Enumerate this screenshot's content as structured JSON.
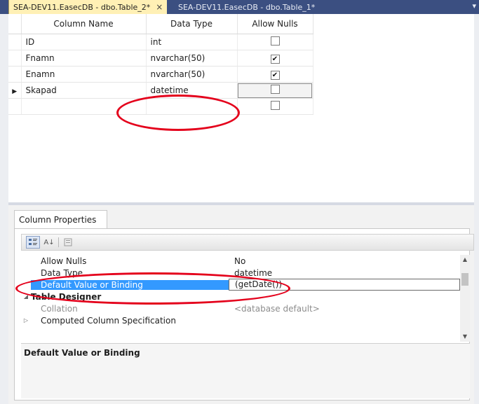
{
  "tabs": {
    "active": "SEA-DEV11.EasecDB - dbo.Table_2*",
    "close_glyph": "×",
    "inactive": "SEA-DEV11.EasecDB - dbo.Table_1*",
    "menu_glyph": "▾"
  },
  "grid": {
    "headers": [
      "Column Name",
      "Data Type",
      "Allow Nulls"
    ],
    "rows": [
      {
        "name": "ID",
        "type": "int",
        "allow_nulls": false
      },
      {
        "name": "Fnamn",
        "type": "nvarchar(50)",
        "allow_nulls": true
      },
      {
        "name": "Enamn",
        "type": "nvarchar(50)",
        "allow_nulls": true
      },
      {
        "name": "Skapad",
        "type": "datetime",
        "allow_nulls": false,
        "current": true
      },
      {
        "name": "",
        "type": "",
        "allow_nulls": false
      }
    ],
    "row_marker": "▶",
    "check_glyph": "✔"
  },
  "properties": {
    "tab_label": "Column Properties",
    "toolbar": {
      "categorized_icon": "categorized-icon",
      "alpha_label": "A↓",
      "property_pages_icon": "property-pages-icon"
    },
    "rows": [
      {
        "name": "Allow Nulls",
        "value": "No"
      },
      {
        "name": "Data Type",
        "value": "datetime"
      },
      {
        "name": "Default Value or Binding",
        "value": "(getDate())"
      },
      {
        "name": "Table Designer",
        "value": ""
      },
      {
        "name": "Collation",
        "value": "<database default>"
      },
      {
        "name": "Computed Column Specification",
        "value": ""
      }
    ],
    "description_title": "Default Value or Binding"
  },
  "colors": {
    "annotation": "#e4001b",
    "selection": "#3399ff",
    "tab_active": "#fff0b5",
    "tab_strip": "#3b4f81"
  }
}
